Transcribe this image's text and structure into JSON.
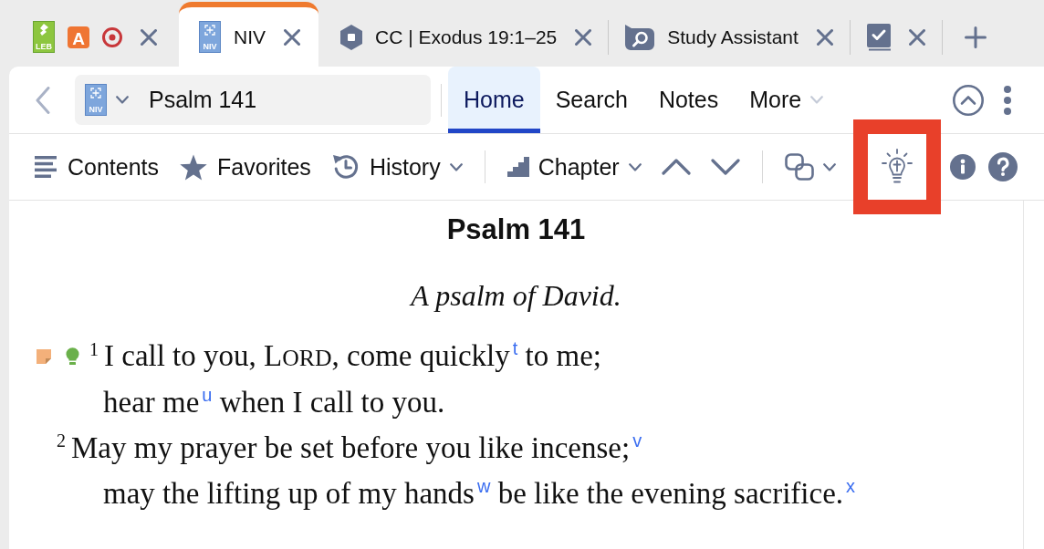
{
  "tabs": [
    {
      "kind": "resource_group",
      "cover_label": "LEB",
      "tile_label": "A",
      "selected": false
    },
    {
      "kind": "book",
      "label": "NIV",
      "cover_label": "NIV",
      "selected": true
    },
    {
      "kind": "commentary",
      "label": "CC | Exodus 19:1–25",
      "selected": false
    },
    {
      "kind": "study_assistant",
      "label": "Study Assistant",
      "selected": false
    },
    {
      "kind": "checklist",
      "selected": false
    }
  ],
  "nav": {
    "reference": {
      "cover_label": "NIV",
      "value": "Psalm 141"
    },
    "tabs": [
      {
        "label": "Home",
        "selected": true,
        "dropdown": false
      },
      {
        "label": "Search",
        "selected": false,
        "dropdown": false
      },
      {
        "label": "Notes",
        "selected": false,
        "dropdown": false
      },
      {
        "label": "More",
        "selected": false,
        "dropdown": true
      }
    ]
  },
  "toolbar": {
    "items": [
      {
        "kind": "contents",
        "label": "Contents",
        "dropdown": false,
        "highlighted": false
      },
      {
        "kind": "favorites",
        "label": "Favorites",
        "dropdown": false,
        "highlighted": false
      },
      {
        "kind": "history",
        "label": "History",
        "dropdown": true,
        "highlighted": false
      },
      {
        "kind": "separator"
      },
      {
        "kind": "chapter",
        "label": "Chapter",
        "dropdown": true,
        "highlighted": false
      },
      {
        "kind": "previous",
        "dropdown": false,
        "highlighted": false
      },
      {
        "kind": "next",
        "dropdown": false,
        "highlighted": false
      },
      {
        "kind": "separator"
      },
      {
        "kind": "link",
        "dropdown": true,
        "highlighted": false
      },
      {
        "kind": "insights",
        "dropdown": false,
        "highlighted": true
      },
      {
        "kind": "info",
        "dropdown": false,
        "highlighted": false
      },
      {
        "kind": "help",
        "dropdown": false,
        "highlighted": false
      }
    ]
  },
  "document": {
    "title": "Psalm 141",
    "subtitle": "A psalm of David.",
    "verses": [
      {
        "number": "1",
        "note": true,
        "insight": true,
        "lines": [
          [
            {
              "kind": "text",
              "text": "I call to you, L"
            },
            {
              "kind": "small_caps",
              "text": "ORD"
            },
            {
              "kind": "text",
              "text": ", come quickly"
            },
            {
              "kind": "footnote",
              "text": "t"
            },
            {
              "kind": "text",
              "text": " to me;"
            }
          ],
          [
            {
              "kind": "text",
              "text": "hear me"
            },
            {
              "kind": "footnote",
              "text": "u"
            },
            {
              "kind": "text",
              "text": " when I call to you."
            }
          ]
        ]
      },
      {
        "number": "2",
        "note": false,
        "insight": false,
        "lines": [
          [
            {
              "kind": "text",
              "text": "May my prayer be set before you like incense;"
            },
            {
              "kind": "footnote",
              "text": "v"
            }
          ],
          [
            {
              "kind": "text",
              "text": "may the lifting up of my hands"
            },
            {
              "kind": "footnote",
              "text": "w"
            },
            {
              "kind": "text",
              "text": " be like the evening sacrifice."
            },
            {
              "kind": "footnote",
              "text": "x"
            }
          ]
        ]
      }
    ]
  }
}
